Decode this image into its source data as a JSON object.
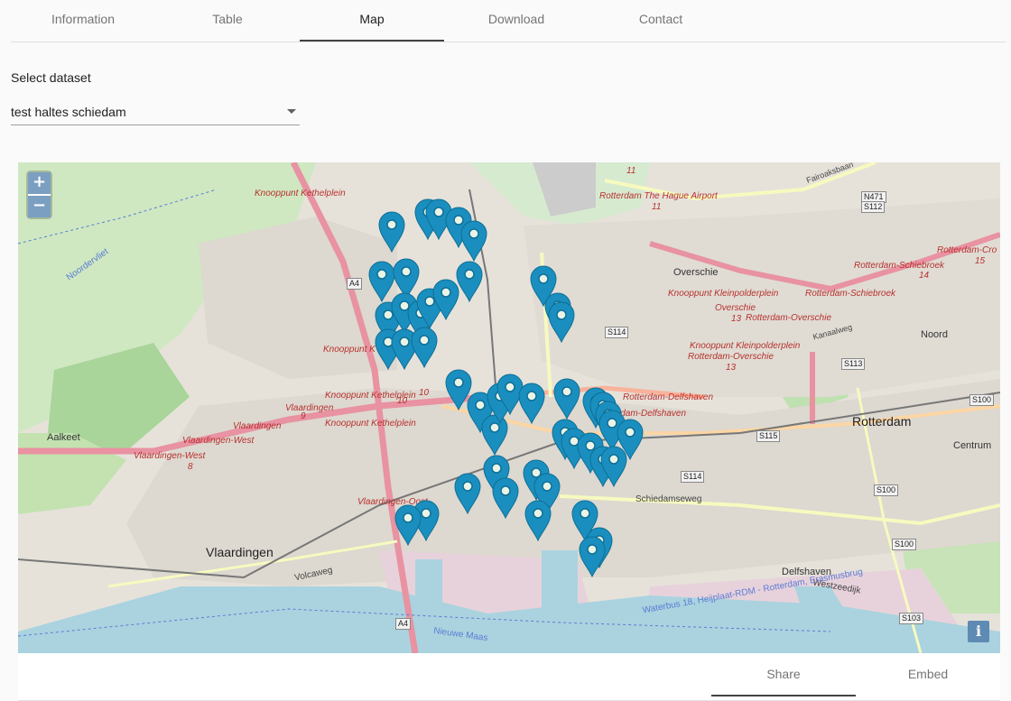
{
  "tabs": [
    {
      "label": "Information"
    },
    {
      "label": "Table"
    },
    {
      "label": "Map"
    },
    {
      "label": "Download"
    },
    {
      "label": "Contact"
    }
  ],
  "dataset_select": {
    "label": "Select dataset",
    "value": "test haltes schiedam"
  },
  "map": {
    "zoom_in": "+",
    "zoom_out": "−",
    "info": "i",
    "marker_color": "#1a8fbf",
    "labels": {
      "knooppunt_kethelplein_top": "Knooppunt Kethelplein",
      "knooppunt_kethelplein_mid": "Knooppunt Kethelplein",
      "knooppunt_kethelplein_low": "Knooppunt Kethelplein",
      "knooppunt_k_left": "Knooppunt K",
      "vlaardingen_1": "Vlaardingen",
      "vlaardingen_2": "Vlaardingen",
      "vlaardingen_west_1": "Vlaardingen-West",
      "vlaardingen_west_2": "Vlaardingen-West",
      "rotterdam_airport": "Rotterdam The Hague Airport",
      "knooppunt_kleinpolderplein_1": "Knooppunt Kleinpolderplein",
      "knooppunt_kleinpolderplein_2": "Knooppunt Kleinpolderplein",
      "overschie_red": "Overschie",
      "rotterdam_overschie_1": "Rotterdam-Overschie",
      "rotterdam_overschie_2": "Rotterdam-Overschie",
      "rotterdam_schiebroek_1": "Rotterdam-Schiebroek",
      "rotterdam_schiebroek_2": "Rotterdam-Schiebroek",
      "rotterdam_crooswijk": "Rotterdam-Cro",
      "rotterdam_delfshaven_1": "Rotterdam-Delfshaven",
      "rotterdam_delfshaven_2": "Rotterdam-Delfshaven",
      "vlaardingen_oost": "Vlaardingen-Oost",
      "num_9": "9",
      "num_8": "8",
      "num_10a": "10",
      "num_10b": "10",
      "num_11a": "11",
      "num_11b": "11",
      "num_13a": "13",
      "num_13b": "13",
      "num_14": "14",
      "num_15": "15"
    },
    "places": {
      "overschie": "Overschie",
      "rotterdam": "Rotterdam",
      "vlaardingen": "Vlaardingen",
      "delfshaven": "Delfshaven",
      "noord": "Noord",
      "centrum": "Centrum",
      "aalkeet": "Aalkeet"
    },
    "shields": {
      "a4_top": "A4",
      "a4_bottom": "A4",
      "s114_1": "S114",
      "s114_2": "S114",
      "s115": "S115",
      "s113": "S113",
      "s100_1": "S100",
      "s100_2": "S100",
      "s100_3": "S100",
      "s103": "S103",
      "n471": "N471",
      "s112": "S112"
    },
    "streets": {
      "schiedamseweg": "Schiedamseweg",
      "westzeedijk": "Westzeedijk",
      "volcaweg": "Volcaweg",
      "nieuwe_maas": "Nieuwe Maas",
      "waterbus": "Waterbus 18, Heijplaat-RDM - Rotterdam, Erasmusbrug",
      "fairoaksbaan": "Fairoaksbaan",
      "kanaalweg": "Kanaalweg",
      "noordervliet": "Noordervliet"
    }
  },
  "bottom_tabs": [
    {
      "label": "Share"
    },
    {
      "label": "Embed"
    }
  ]
}
